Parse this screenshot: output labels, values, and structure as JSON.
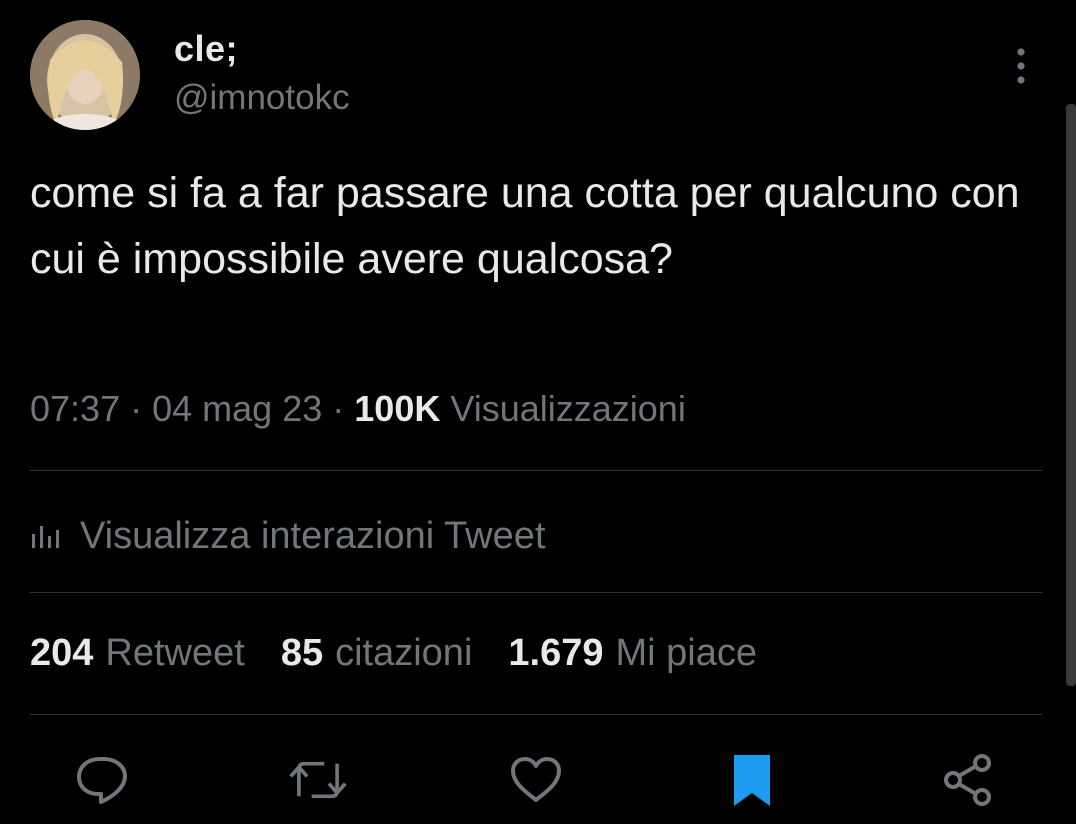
{
  "author": {
    "display_name": "cle;",
    "handle": "@imnotokc"
  },
  "tweet": {
    "text": "come si fa a far passare una cotta per qualcuno con cui è impossibile avere qualcosa?"
  },
  "meta": {
    "time": "07:37",
    "separator": "·",
    "date": "04 mag 23",
    "views_count": "100K",
    "views_label": "Visualizzazioni"
  },
  "interactions": {
    "icon": "analytics-bars-icon",
    "label": "Visualizza interazioni Tweet"
  },
  "stats": {
    "retweets_count": "204",
    "retweets_label": "Retweet",
    "quotes_count": "85",
    "quotes_label": "citazioni",
    "likes_count": "1.679",
    "likes_label": "Mi piace"
  },
  "actions": [
    {
      "name": "reply",
      "icon": "reply-icon"
    },
    {
      "name": "retweet",
      "icon": "retweet-icon"
    },
    {
      "name": "like",
      "icon": "heart-icon"
    },
    {
      "name": "bookmark",
      "icon": "bookmark-icon",
      "active": true
    },
    {
      "name": "share",
      "icon": "share-icon"
    }
  ],
  "colors": {
    "background": "#000000",
    "text_primary": "#e7e9ea",
    "text_secondary": "#71767b",
    "divider": "#2f3336",
    "bookmark_active": "#1d9bf0"
  }
}
